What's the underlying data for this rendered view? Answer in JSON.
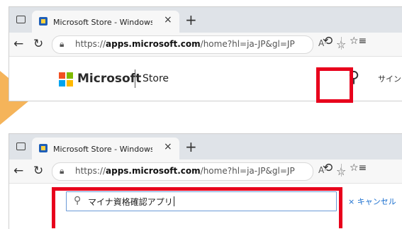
{
  "colors": {
    "highlight": "#e8001c",
    "arrow": "#f5b45a",
    "accent": "#1a6fcf"
  },
  "browser": {
    "tab_title": "Microsoft Store - Windows PC用ア",
    "tab_close": "×",
    "new_tab": "+",
    "back": "←",
    "reload": "↻",
    "url_prefix": "https://",
    "url_host": "apps.microsoft.com",
    "url_path": "/home?hl=ja-JP&gl=JP",
    "read_aloud": "A⁾",
    "favorite": "☆",
    "extensions": "⟲",
    "favorites_list": "☆≡"
  },
  "store": {
    "brand": "Microsoft",
    "name": "Store",
    "signin": "サインイ",
    "search_placeholder_value": "マイナ資格確認アプリ",
    "cancel": "× キャンセル"
  },
  "icons": {
    "search": "search-icon",
    "lock": "lock-icon",
    "tabs": "tab-actions-icon"
  }
}
